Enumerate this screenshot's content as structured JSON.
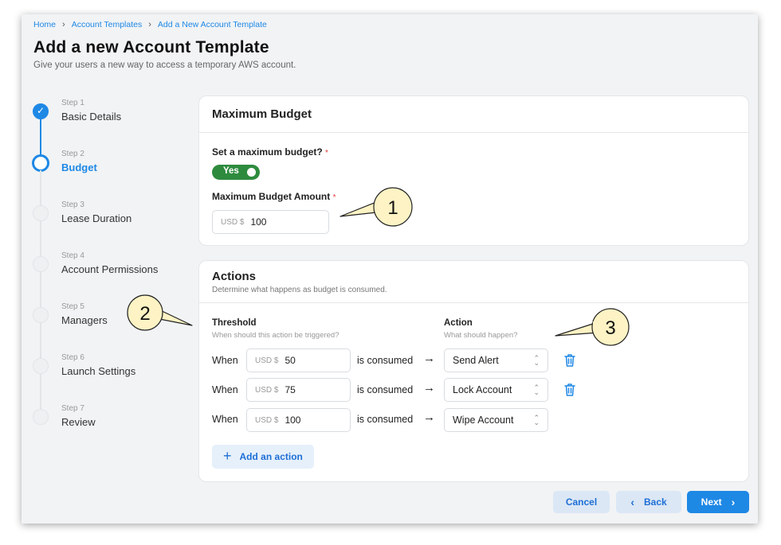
{
  "breadcrumb": [
    "Home",
    "Account Templates",
    "Add a New Account Template"
  ],
  "page": {
    "title": "Add a new Account Template",
    "subtitle": "Give your users a new way to access a temporary AWS account."
  },
  "steps": [
    {
      "num": "Step 1",
      "label": "Basic Details",
      "state": "done"
    },
    {
      "num": "Step 2",
      "label": "Budget",
      "state": "current"
    },
    {
      "num": "Step 3",
      "label": "Lease Duration",
      "state": "todo"
    },
    {
      "num": "Step 4",
      "label": "Account Permissions",
      "state": "todo"
    },
    {
      "num": "Step 5",
      "label": "Managers",
      "state": "todo"
    },
    {
      "num": "Step 6",
      "label": "Launch Settings",
      "state": "todo"
    },
    {
      "num": "Step 7",
      "label": "Review",
      "state": "todo"
    }
  ],
  "budget_card": {
    "title": "Maximum Budget",
    "set_label": "Set a maximum budget?",
    "required_mark": "*",
    "toggle_label": "Yes",
    "amount_label": "Maximum Budget Amount",
    "currency_prefix": "USD $",
    "amount_value": "100"
  },
  "actions_card": {
    "title": "Actions",
    "description": "Determine what happens as budget is consumed.",
    "threshold_header": "Threshold",
    "threshold_sub": "When should this action be triggered?",
    "action_header": "Action",
    "action_sub": "What should happen?",
    "when_label": "When",
    "consumed_label": "is consumed",
    "currency_prefix": "USD $",
    "rows": [
      {
        "threshold": "50",
        "action": "Send Alert",
        "deletable": true
      },
      {
        "threshold": "75",
        "action": "Lock Account",
        "deletable": true
      },
      {
        "threshold": "100",
        "action": "Wipe Account",
        "deletable": false
      }
    ],
    "add_label": "Add an action"
  },
  "footer": {
    "cancel": "Cancel",
    "back": "Back",
    "next": "Next"
  },
  "callouts": [
    "1",
    "2",
    "3"
  ],
  "colors": {
    "accent": "#1e88e5",
    "toggle_on": "#2e8b3e",
    "required": "#e53935",
    "callout_fill": "#fdf3c4"
  }
}
